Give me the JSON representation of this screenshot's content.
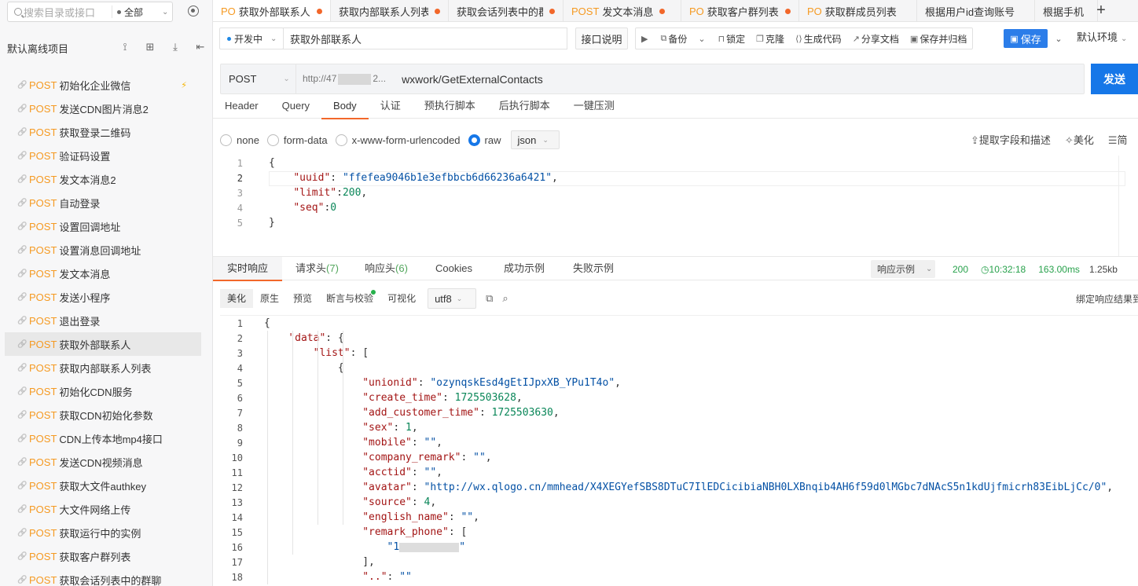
{
  "sidebar": {
    "search_placeholder": "搜索目录或接口",
    "scope": "全部",
    "project": "默认离线项目",
    "method": "POST",
    "items": [
      {
        "name": "初始化企业微信",
        "active": false
      },
      {
        "name": "发送CDN图片消息2",
        "active": false
      },
      {
        "name": "获取登录二维码",
        "active": false
      },
      {
        "name": "验证码设置",
        "active": false
      },
      {
        "name": "发文本消息2",
        "active": false
      },
      {
        "name": "自动登录",
        "active": false
      },
      {
        "name": "设置回调地址",
        "active": false
      },
      {
        "name": "设置消息回调地址",
        "active": false
      },
      {
        "name": "发文本消息",
        "active": false
      },
      {
        "name": "发送小程序",
        "active": false
      },
      {
        "name": "退出登录",
        "active": false
      },
      {
        "name": "获取外部联系人",
        "active": true
      },
      {
        "name": "获取内部联系人列表",
        "active": false
      },
      {
        "name": "初始化CDN服务",
        "active": false
      },
      {
        "name": "获取CDN初始化参数",
        "active": false
      },
      {
        "name": "CDN上传本地mp4接口",
        "active": false
      },
      {
        "name": "发送CDN视频消息",
        "active": false
      },
      {
        "name": "获取大文件authkey",
        "active": false
      },
      {
        "name": "大文件网络上传",
        "active": false
      },
      {
        "name": "获取运行中的实例",
        "active": false
      },
      {
        "name": "获取客户群列表",
        "active": false
      },
      {
        "name": "获取会话列表中的群聊",
        "active": false
      }
    ]
  },
  "tabs": [
    {
      "method": "PO",
      "name": "获取外部联系人",
      "width": 150,
      "active": true
    },
    {
      "method": "",
      "name": "获取内部联系人列表",
      "width": 150,
      "active": false
    },
    {
      "method": "",
      "name": "获取会话列表中的群",
      "width": 146,
      "active": false
    },
    {
      "method": "POST",
      "name": "发文本消息",
      "width": 150,
      "active": false
    },
    {
      "method": "PO",
      "name": "获取客户群列表",
      "width": 150,
      "active": false
    },
    {
      "method": "PO",
      "name": "获取群成员列表",
      "width": 150,
      "active": false
    },
    {
      "method": "",
      "name": "根据用户id查询账号",
      "width": 150,
      "active": false
    },
    {
      "method": "",
      "name": "根据手机",
      "width": 80,
      "active": false
    }
  ],
  "toolbar": {
    "status": "开发中",
    "api_name": "获取外部联系人",
    "doc_label": "接口说明",
    "actions": [
      {
        "icon": "play-icon",
        "glyph": "▶",
        "label": ""
      },
      {
        "icon": "backup-icon",
        "glyph": "⧉",
        "label": "备份"
      },
      {
        "icon": "chevron-down-icon",
        "glyph": "⌄",
        "label": ""
      },
      {
        "icon": "lock-icon",
        "glyph": "⊓",
        "label": "锁定"
      },
      {
        "icon": "clone-icon",
        "glyph": "❐",
        "label": "克隆"
      },
      {
        "icon": "code-icon",
        "glyph": "⟨⟩",
        "label": "生成代码"
      },
      {
        "icon": "share-icon",
        "glyph": "↗",
        "label": "分享文档"
      },
      {
        "icon": "archive-icon",
        "glyph": "▣",
        "label": "保存并归档"
      }
    ],
    "save_label": "保存",
    "environment": "默认环境"
  },
  "url": {
    "method": "POST",
    "host": "http://47",
    "host_suffix": "2...",
    "path": "wxwork/GetExternalContacts",
    "send_label": "发送"
  },
  "request_tabs": [
    "Header",
    "Query",
    "Body",
    "认证",
    "预执行脚本",
    "后执行脚本",
    "一键压测"
  ],
  "body_types": [
    {
      "label": "none",
      "on": false
    },
    {
      "label": "form-data",
      "on": false
    },
    {
      "label": "x-www-form-urlencoded",
      "on": false
    },
    {
      "label": "raw",
      "on": true
    }
  ],
  "raw_format": "json",
  "body_tools": [
    "提取字段和描述",
    "美化",
    "简"
  ],
  "request_body": [
    "{",
    "    \"uuid\": \"ffefea9046b1e3efbbcb6d66236a6421\",",
    "    \"limit\":200,",
    "    \"seq\":0",
    "}"
  ],
  "response_tabs": [
    {
      "label": "实时响应",
      "count": ""
    },
    {
      "label": "请求头",
      "count": "(7)"
    },
    {
      "label": "响应头",
      "count": "(6)"
    },
    {
      "label": "Cookies",
      "count": ""
    },
    {
      "label": "成功示例",
      "count": ""
    },
    {
      "label": "失败示例",
      "count": ""
    }
  ],
  "response_meta": {
    "example_label": "响应示例",
    "status": "200",
    "time": "10:32:18",
    "duration": "163.00ms",
    "size": "1.25kb"
  },
  "response_tools": [
    "美化",
    "原生",
    "预览",
    "断言与校验",
    "可视化"
  ],
  "encoding": "utf8",
  "bind_note": "绑定响应结果到",
  "response_body": [
    "{",
    "    \"data\": {",
    "        \"list\": [",
    "            {",
    "                \"unionid\": \"ozynqskEsd4gEtIJpxXB_YPu1T4o\",",
    "                \"create_time\": 1725503628,",
    "                \"add_customer_time\": 1725503630,",
    "                \"sex\": 1,",
    "                \"mobile\": \"\",",
    "                \"company_remark\": \"\",",
    "                \"acctid\": \"\",",
    "                \"avatar\": \"http://wx.qlogo.cn/mmhead/X4XEGYefSBS8DTuC7IlEDCicibiaNBH0LXBnqib4AH6f59d0lMGbc7dNAcS5n1kdUjfmicrh83EibLjCc/0\",",
    "                \"source\": 4,",
    "                \"english_name\": \"\",",
    "                \"remark_phone\": [",
    "                    \"1",
    "                ],",
    "                \"..\": \"\""
  ]
}
